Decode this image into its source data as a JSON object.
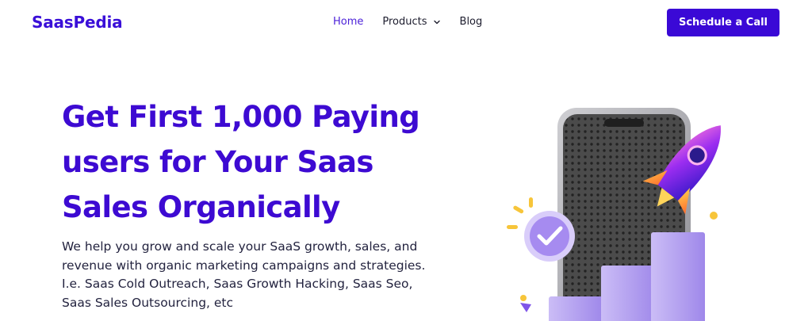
{
  "brand": {
    "name": "SaasPedia"
  },
  "nav": {
    "items": [
      {
        "label": "Home",
        "active": true
      },
      {
        "label": "Products",
        "has_dropdown": true
      },
      {
        "label": "Blog"
      }
    ]
  },
  "header": {
    "cta_label": "Schedule a Call"
  },
  "hero": {
    "title_lines": [
      "Get First 1,000 Paying",
      "users for Your Saas",
      "Sales Organically"
    ],
    "description": "We help you grow and scale your SaaS growth, sales, and revenue with organic marketing campaigns and strategies. I.e. Saas Cold Outreach, Saas Growth Hacking, Saas Seo, Saas Sales Outsourcing, etc"
  },
  "illustration": {
    "icons": [
      "phone-icon",
      "rocket-icon",
      "check-badge-icon",
      "bar-chart-icon"
    ]
  },
  "colors": {
    "brand": "#3a0fd8",
    "cta_bg": "#3a09d6",
    "title": "#3d0ad2",
    "nav_active": "#4a1fd8",
    "text": "#23233f",
    "bars": "#b8a8f0"
  }
}
